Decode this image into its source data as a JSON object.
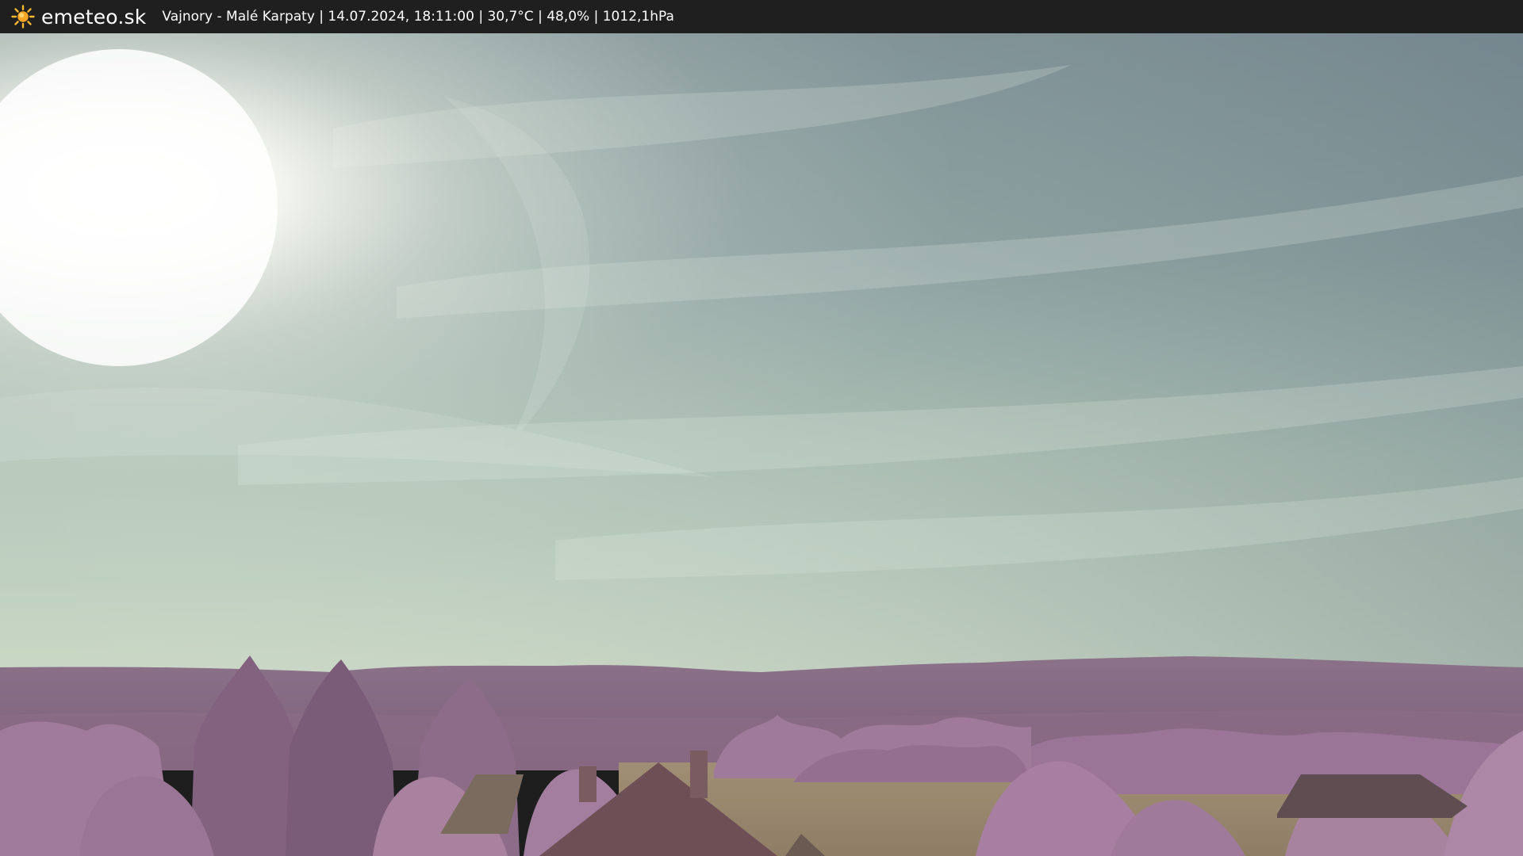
{
  "brand": {
    "logo_icon": "sun-icon",
    "name": "emeteo.sk",
    "accent": "#f5a623"
  },
  "caption": "Vajnory - Malé Karpaty | 14.07.2024, 18:11:00 | 30,7°C | 48,0% | 1012,1hPa",
  "colors": {
    "bar": "#1f1f1f",
    "sky_top": "#7e8f92",
    "sky_horizon": "#c9d6c4",
    "hills": "#8a6a85",
    "foliage": "#a27a9c",
    "field": "#9c8a6e"
  }
}
